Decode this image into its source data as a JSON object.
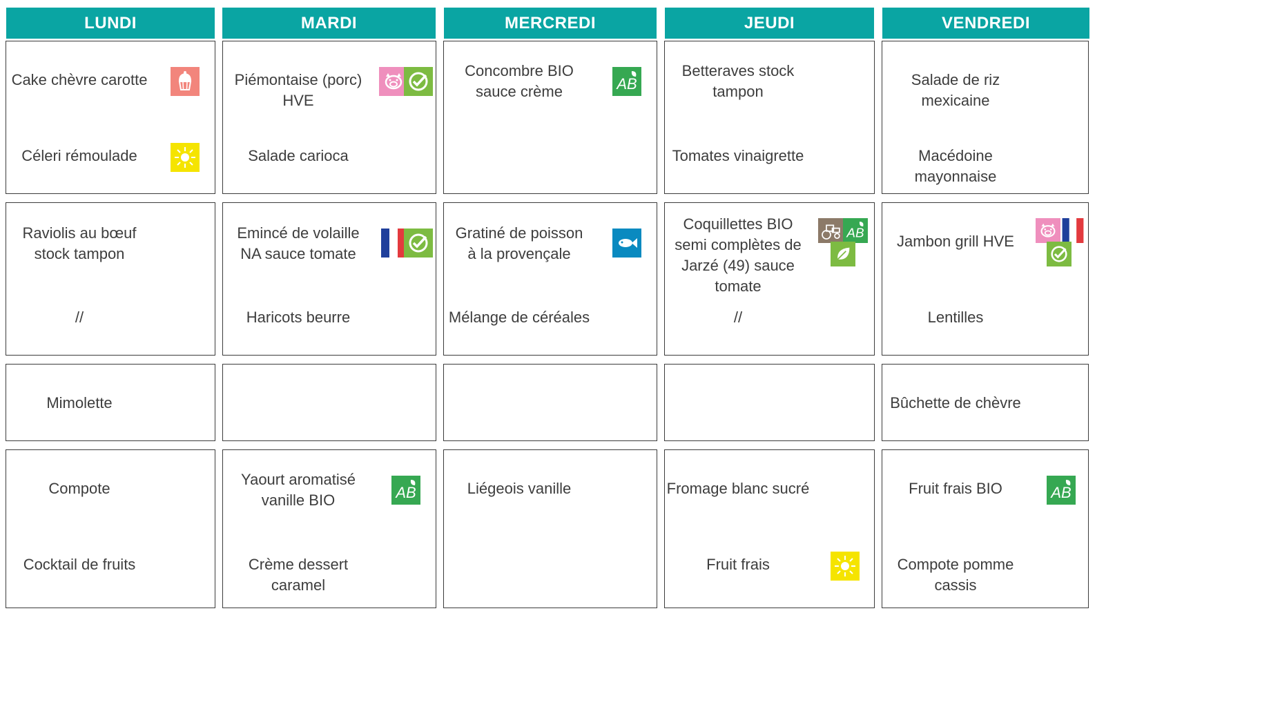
{
  "days": [
    "LUNDI",
    "MARDI",
    "MERCREDI",
    "JEUDI",
    "VENDREDI"
  ],
  "menu": {
    "lundi": {
      "entree1": "Cake chèvre carotte",
      "entree2": "Céleri rémoulade",
      "plat": "Raviolis au bœuf stock tampon",
      "accompagnement": "//",
      "fromage": "Mimolette",
      "dessert1": "Compote",
      "dessert2": "Cocktail de fruits"
    },
    "mardi": {
      "entree1": "Piémontaise (porc) HVE",
      "entree2": "Salade carioca",
      "plat": "Emincé de volaille NA sauce tomate",
      "accompagnement": "Haricots beurre",
      "fromage": "",
      "dessert1": "Yaourt aromatisé vanille BIO",
      "dessert2": "Crème dessert caramel"
    },
    "mercredi": {
      "entree1": "Concombre BIO sauce crème",
      "entree2": "",
      "plat": "Gratiné de poisson à la provençale",
      "accompagnement": "Mélange de céréales",
      "fromage": "",
      "dessert1": "Liégeois vanille",
      "dessert2": ""
    },
    "jeudi": {
      "entree1": "Betteraves stock tampon",
      "entree2": "Tomates vinaigrette",
      "plat": "Coquillettes BIO semi complètes de Jarzé (49) sauce tomate",
      "accompagnement": "//",
      "fromage": "",
      "dessert1": "Fromage blanc sucré",
      "dessert2": "Fruit frais"
    },
    "vendredi": {
      "entree1": "Salade de riz mexicaine",
      "entree2": "Macédoine mayonnaise",
      "plat": "Jambon grill HVE",
      "accompagnement": "Lentilles",
      "fromage": "Bûchette de chèvre",
      "dessert1": "Fruit frais BIO",
      "dessert2": "Compote pomme cassis"
    }
  },
  "icons": {
    "lundi_entree1": [
      "cupcake-icon"
    ],
    "lundi_entree2": [
      "sun-icon"
    ],
    "mardi_entree1": [
      "pig-icon",
      "checkmark-hve-icon"
    ],
    "mardi_plat": [
      "french-flag-icon",
      "checkmark-hve-icon"
    ],
    "mercredi_entree1": [
      "ab-bio-icon"
    ],
    "mercredi_plat": [
      "fish-icon"
    ],
    "jeudi_plat": [
      "tractor-icon",
      "ab-bio-icon",
      "leaf-icon"
    ],
    "jeudi_dessert2": [
      "sun-icon"
    ],
    "mardi_dessert1": [
      "ab-bio-icon"
    ],
    "vendredi_plat": [
      "pig-icon",
      "french-flag-icon",
      "checkmark-hve-icon"
    ],
    "vendredi_dessert1": [
      "ab-bio-icon"
    ]
  },
  "colors": {
    "header_bg": "#0aa5a3",
    "header_text": "#ffffff",
    "ab_green": "#36a852",
    "hve_green": "#7dbb42",
    "pig_pink": "#ef8fbd",
    "cake_salmon": "#f2857c",
    "sun_yellow": "#f5e400",
    "fish_blue": "#0a8ac0",
    "tractor_brown": "#8c7a68"
  }
}
